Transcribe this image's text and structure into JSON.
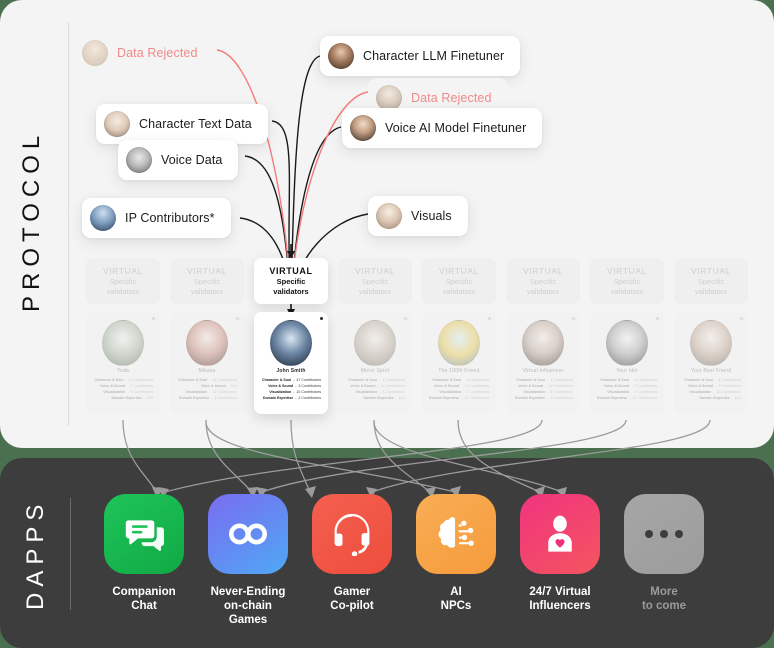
{
  "sections": {
    "protocol_label": "PROTOCOL",
    "dapps_label": "DAPPS"
  },
  "colors": {
    "page_background": "#4a7050",
    "protocol_panel": "#f4f4f4",
    "dapps_panel": "#3d3d3d",
    "rejected_text": "#f08a8a",
    "rejected_wire": "#f47b7b",
    "wire": "#1a1a1a",
    "arrow": "#9b9b9b"
  },
  "protocol": {
    "chips": [
      {
        "id": "data-rejected-left",
        "label": "Data Rejected",
        "state": "rejected",
        "avatar": "av-a"
      },
      {
        "id": "character-llm-finetuner",
        "label": "Character LLM Finetuner",
        "state": "normal",
        "avatar": "av-e"
      },
      {
        "id": "character-text-data",
        "label": "Character Text Data",
        "state": "normal",
        "avatar": "av-c"
      },
      {
        "id": "data-rejected-right",
        "label": "Data Rejected",
        "state": "rejected",
        "avatar": "av-b"
      },
      {
        "id": "voice-data",
        "label": "Voice Data",
        "state": "normal",
        "avatar": "av-d"
      },
      {
        "id": "voice-ai-model-finetuner",
        "label": "Voice AI Model Finetuner",
        "state": "normal",
        "avatar": "av-f"
      },
      {
        "id": "ip-contributors",
        "label": "IP Contributors*",
        "state": "normal",
        "avatar": "av-g"
      },
      {
        "id": "visuals",
        "label": "Visuals",
        "state": "normal",
        "avatar": "av-h"
      }
    ],
    "validator_badge": {
      "line1": "VIRTUAL",
      "line2": "Specific",
      "line3": "validators"
    },
    "validator_count": 8,
    "active_validator_index": 2,
    "cards": [
      {
        "name": "Yoda",
        "portrait": "pc-1",
        "rows": [
          {
            "key": "Character & Soul",
            "value": "11 Contributors"
          },
          {
            "key": "Voice & Sound",
            "value": "2 Contributors"
          },
          {
            "key": "Visualization",
            "value": "9 Contributors"
          },
          {
            "key": "Domain Expertise",
            "value": "N/A"
          }
        ]
      },
      {
        "name": "Mikasa",
        "portrait": "pc-2",
        "rows": [
          {
            "key": "Character & Soul",
            "value": "24 Contributors"
          },
          {
            "key": "Voice & Sound",
            "value": "N/A"
          },
          {
            "key": "Visualization",
            "value": "12 Contributors"
          },
          {
            "key": "Domain Expertise",
            "value": "4 Contributors"
          }
        ]
      },
      {
        "name": "John Smith",
        "portrait": "pc-3",
        "rows": [
          {
            "key": "Character & Soul",
            "value": "47 Contributors"
          },
          {
            "key": "Voice & Sound",
            "value": "3 Contributors"
          },
          {
            "key": "Visualization",
            "value": "10 Contributors"
          },
          {
            "key": "Domain Expertise",
            "value": "2 Contributors"
          }
        ]
      },
      {
        "name": "Mirror Spirit",
        "portrait": "pc-4",
        "rows": [
          {
            "key": "Character & Soul",
            "value": "3 Contributors"
          },
          {
            "key": "Voice & Sound",
            "value": "11 Contributors"
          },
          {
            "key": "Visualization",
            "value": "4 Contributors"
          },
          {
            "key": "Domain Expertise",
            "value": "N/A"
          }
        ]
      },
      {
        "name": "The 100th Friend",
        "portrait": "pc-5",
        "rows": [
          {
            "key": "Character & Soul",
            "value": "3 Contributors"
          },
          {
            "key": "Voice & Sound",
            "value": "17 Contributors"
          },
          {
            "key": "Visualization",
            "value": "3 Contributors"
          },
          {
            "key": "Domain Expertise",
            "value": "12 Contributors"
          }
        ]
      },
      {
        "name": "Virtual Influencer",
        "portrait": "pc-6",
        "rows": [
          {
            "key": "Character & Soul",
            "value": "3 Contributors"
          },
          {
            "key": "Voice & Sound",
            "value": "14 Contributors"
          },
          {
            "key": "Visualization",
            "value": "8 Contributors"
          },
          {
            "key": "Domain Expertise",
            "value": "9 Contributors"
          }
        ]
      },
      {
        "name": "Your Idol",
        "portrait": "pc-7",
        "rows": [
          {
            "key": "Character & Soul",
            "value": "6 Contributors"
          },
          {
            "key": "Voice & Sound",
            "value": "3 Contributors"
          },
          {
            "key": "Visualization",
            "value": "4 Contributors"
          },
          {
            "key": "Domain Expertise",
            "value": "10 Contributors"
          }
        ]
      },
      {
        "name": "Your Best Friend",
        "portrait": "pc-8",
        "rows": [
          {
            "key": "Character & Soul",
            "value": "8 Contributors"
          },
          {
            "key": "Voice & Sound",
            "value": "3 Contributors"
          },
          {
            "key": "Visualization",
            "value": "12 Contributors"
          },
          {
            "key": "Domain Expertise",
            "value": "N/A"
          }
        ]
      }
    ]
  },
  "dapps": {
    "apps": [
      {
        "id": "companion-chat",
        "name": "Companion\nChat",
        "icon": "chat-bubbles-icon",
        "color_start": "#1ec45a",
        "color_end": "#11a945"
      },
      {
        "id": "never-ending-onchain-games",
        "name": "Never-Ending\non-chain Games",
        "icon": "infinity-icon",
        "color_start": "#7a6cf0",
        "color_end": "#4fa8f5"
      },
      {
        "id": "gamer-copilot",
        "name": "Gamer\nCo-pilot",
        "icon": "headset-icon",
        "color_start": "#f4604f",
        "color_end": "#ee4d3d"
      },
      {
        "id": "ai-npcs",
        "name": "AI\nNPCs",
        "icon": "brain-circuit-icon",
        "color_start": "#f9ad54",
        "color_end": "#f59b3c"
      },
      {
        "id": "virtual-influencers",
        "name": "24/7 Virtual\nInfluencers",
        "icon": "person-heart-icon",
        "color_start": "#f0337f",
        "color_end": "#f4555f"
      },
      {
        "id": "more-to-come",
        "name": "More\nto come",
        "icon": "ellipsis-icon",
        "color_start": "#a6a6a6",
        "color_end": "#9c9c9c"
      }
    ]
  }
}
